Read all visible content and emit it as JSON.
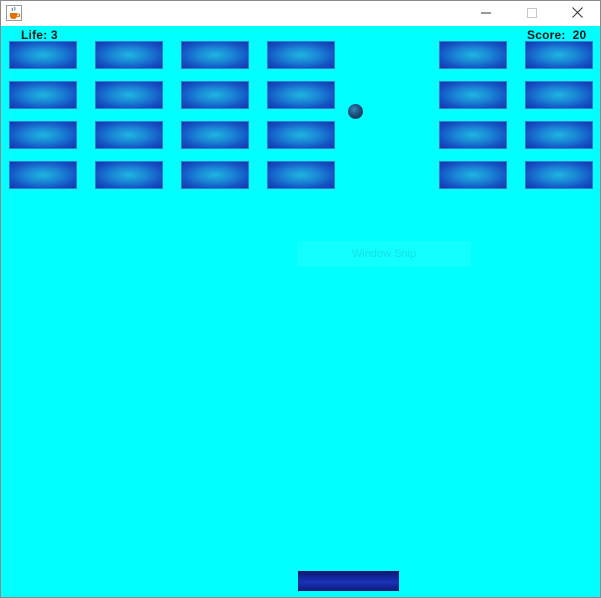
{
  "window": {
    "app_icon": "java-coffee-cup-icon",
    "controls": [
      "minimize-icon",
      "maximize-icon",
      "close-icon"
    ]
  },
  "hud": {
    "life_label": "Life:",
    "life_value": "3",
    "score_label": "Score:",
    "score_value": "20"
  },
  "game": {
    "background_color": "#00ffff",
    "brick_colors": {
      "center": "#1fb5e0",
      "edge": "#1237ad"
    },
    "brick_columns": 7,
    "brick_rows": 4,
    "bricks_remaining": 24,
    "bricks_destroyed_column": 5,
    "ball_color": "#1d4f7d",
    "paddle_color": "#162cad"
  },
  "overlay": {
    "watermark_text": "Window Snip"
  }
}
